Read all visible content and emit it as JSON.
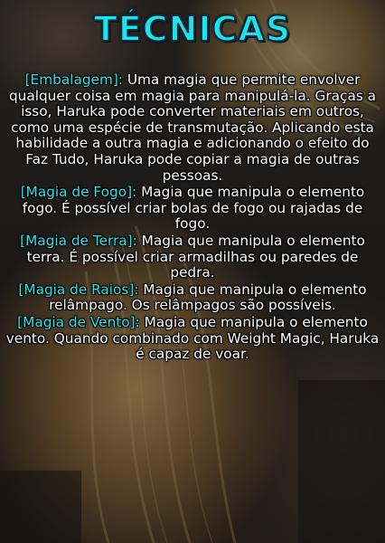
{
  "title": "TÉCNICAS",
  "entries": [
    {
      "term": "[Embalagem]:",
      "text": " Uma magia que permite envolver qualquer coisa em magia para manipulá-la. Graças a isso, Haruka pode converter materiais em outros, como uma espécie de transmutação. Aplicando esta habilidade a outra magia e adicionando o efeito do Faz Tudo, Haruka pode copiar a magia de outras pessoas."
    },
    {
      "term": "[Magia de Fogo]:",
      "text": " Magia que manipula o elemento fogo. É possível criar bolas de fogo ou rajadas de fogo."
    },
    {
      "term": "[Magia de Terra]:",
      "text": " Magia que manipula o elemento terra. É possível criar armadilhas ou paredes de pedra."
    },
    {
      "term": "[Magia de Raios]:",
      "text": " Magia que manipula o elemento relâmpago. Os relâmpagos são possíveis."
    },
    {
      "term": "[Magia de Vento]:",
      "text": " Magia que manipula o elemento vento. Quando combinado com Weight Magic, Haruka é capaz de voar."
    }
  ],
  "colors": {
    "title": "#1ee3ea",
    "term": "#24e4ec",
    "body_text": "#ffffff"
  }
}
